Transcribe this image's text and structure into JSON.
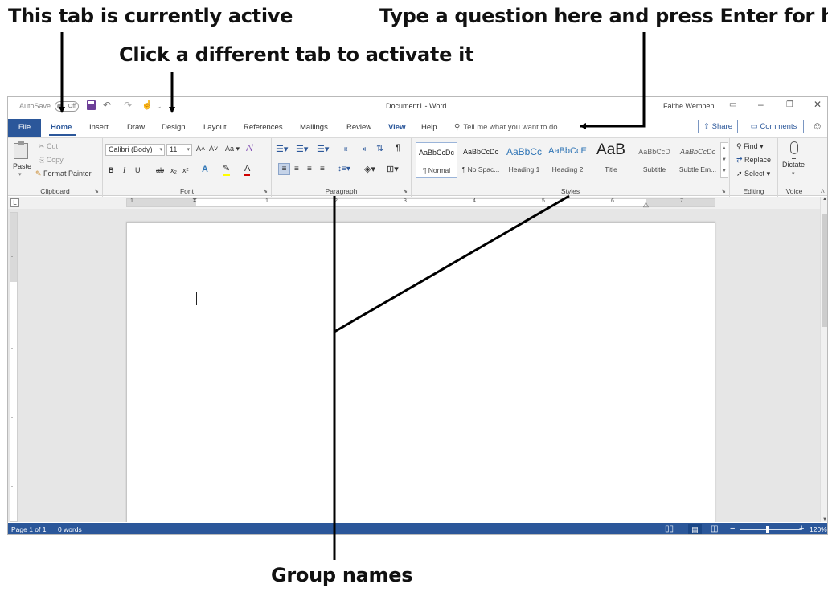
{
  "callouts": {
    "active_tab": "This tab is currently active",
    "help": "Type a question here and press Enter for help",
    "activate": "Click a different tab to activate it",
    "groups": "Group names"
  },
  "titlebar": {
    "autosave": "AutoSave",
    "autosave_state": "Off",
    "document_title": "Document1 - Word",
    "user": "Faithe Wempen"
  },
  "tabs": {
    "file": "File",
    "home": "Home",
    "insert": "Insert",
    "draw": "Draw",
    "design": "Design",
    "layout": "Layout",
    "references": "References",
    "mailings": "Mailings",
    "review": "Review",
    "view": "View",
    "help": "Help"
  },
  "tell_me": {
    "placeholder": "Tell me what you want to do"
  },
  "share_label": "Share",
  "comments_label": "Comments",
  "ribbon": {
    "clipboard": {
      "name": "Clipboard",
      "paste": "Paste",
      "cut": "Cut",
      "copy": "Copy",
      "format_painter": "Format Painter"
    },
    "font": {
      "name": "Font",
      "font_name": "Calibri (Body)",
      "font_size": "11"
    },
    "paragraph": {
      "name": "Paragraph"
    },
    "styles": {
      "name": "Styles",
      "items": [
        {
          "preview": "AaBbCcDc",
          "label": "¶ Normal"
        },
        {
          "preview": "AaBbCcDc",
          "label": "¶ No Spac..."
        },
        {
          "preview": "AaBbCc",
          "label": "Heading 1"
        },
        {
          "preview": "AaBbCcE",
          "label": "Heading 2"
        },
        {
          "preview": "AaB",
          "label": "Title"
        },
        {
          "preview": "AaBbCcD",
          "label": "Subtitle"
        },
        {
          "preview": "AaBbCcDc",
          "label": "Subtle Em..."
        }
      ]
    },
    "editing": {
      "name": "Editing",
      "find": "Find",
      "replace": "Replace",
      "select": "Select"
    },
    "voice": {
      "name": "Voice",
      "dictate": "Dictate"
    }
  },
  "ruler": {
    "h_numbers": [
      "1",
      "1",
      "2",
      "3",
      "4",
      "5",
      "6",
      "7"
    ]
  },
  "statusbar": {
    "page": "Page 1 of 1",
    "words": "0 words",
    "zoom": "120%",
    "zoom_fraction": 0.45
  },
  "colors": {
    "word_blue": "#2b579a",
    "callout_arrow": "#000000"
  },
  "icons": [
    "save-icon",
    "undo-icon",
    "redo-icon",
    "touch-mode-icon",
    "search-icon",
    "share-icon",
    "comment-icon",
    "smiley-icon",
    "paste-icon",
    "cut-icon",
    "copy-icon",
    "format-painter-icon",
    "find-icon",
    "replace-icon",
    "select-icon",
    "microphone-icon",
    "read-mode-icon",
    "print-layout-icon",
    "web-layout-icon"
  ]
}
